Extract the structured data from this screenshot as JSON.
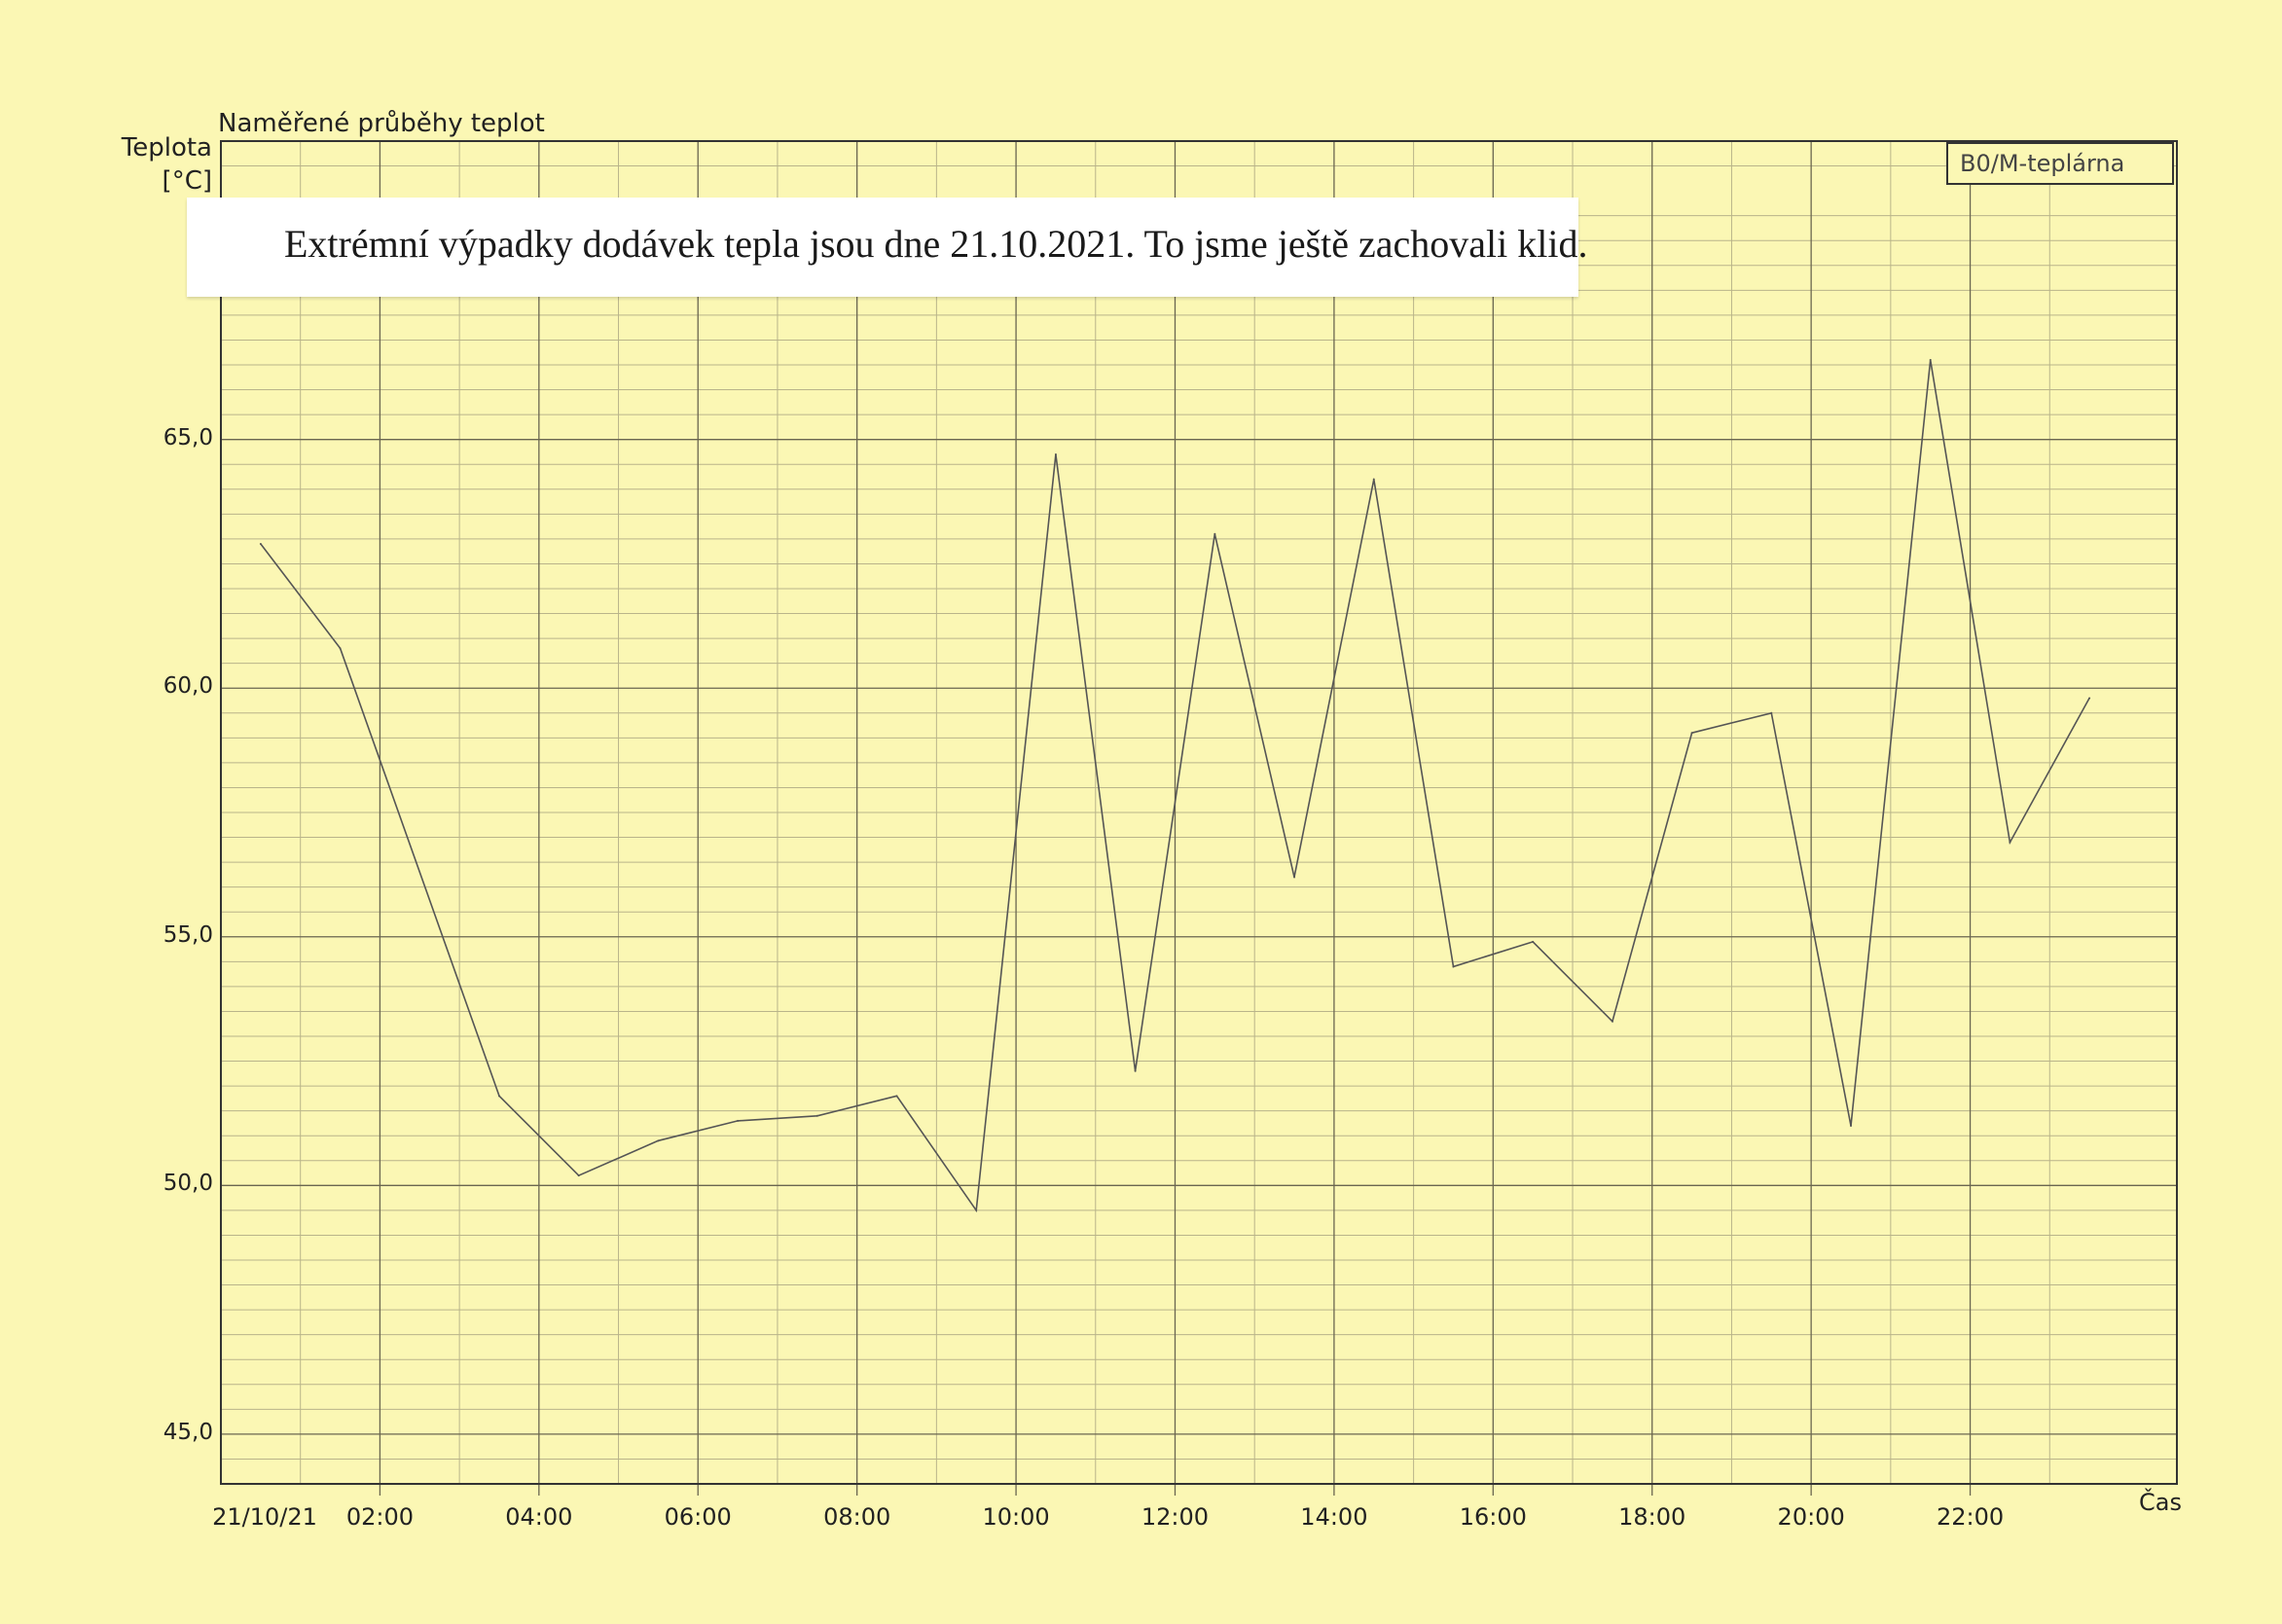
{
  "chart_data": {
    "type": "line",
    "title": "Naměřené průběhy teplot",
    "ylabel": "Teplota\n[°C]",
    "xlabel": "Čas",
    "legend": [
      "B0/M-teplárna"
    ],
    "annotation": "Extrémní výpadky dodávek tepla jsou dne 21.10.2021.  To jsme ještě zachovali klid.",
    "ylim": [
      44,
      71
    ],
    "y_ticks": [
      45,
      50,
      55,
      60,
      65
    ],
    "y_tick_labels": [
      "45,0",
      "50,0",
      "55,0",
      "60,0",
      "65,0"
    ],
    "xlim": [
      0,
      24.6
    ],
    "x_ticks": [
      0,
      2,
      4,
      6,
      8,
      10,
      12,
      14,
      16,
      18,
      20,
      22
    ],
    "x_tick_labels": [
      "21/10/21",
      "02:00",
      "04:00",
      "06:00",
      "08:00",
      "10:00",
      "12:00",
      "14:00",
      "16:00",
      "18:00",
      "20:00",
      "22:00"
    ],
    "grid": true,
    "color": "#555555",
    "series": [
      {
        "name": "B0/M-teplárna",
        "x": [
          0.5,
          1.5,
          3.5,
          4.5,
          5.5,
          6.5,
          7.5,
          8.5,
          9.5,
          10.5,
          11.5,
          12.5,
          13.5,
          14.5,
          15.5,
          16.5,
          17.5,
          18.5,
          19.5,
          20.5,
          21.5,
          22.5,
          23.5
        ],
        "y": [
          62.9,
          60.8,
          51.8,
          50.2,
          50.9,
          51.3,
          51.4,
          51.8,
          49.5,
          64.7,
          52.3,
          63.1,
          56.2,
          64.2,
          54.4,
          54.9,
          53.3,
          59.1,
          59.5,
          51.2,
          66.6,
          56.9,
          59.8
        ]
      }
    ]
  }
}
